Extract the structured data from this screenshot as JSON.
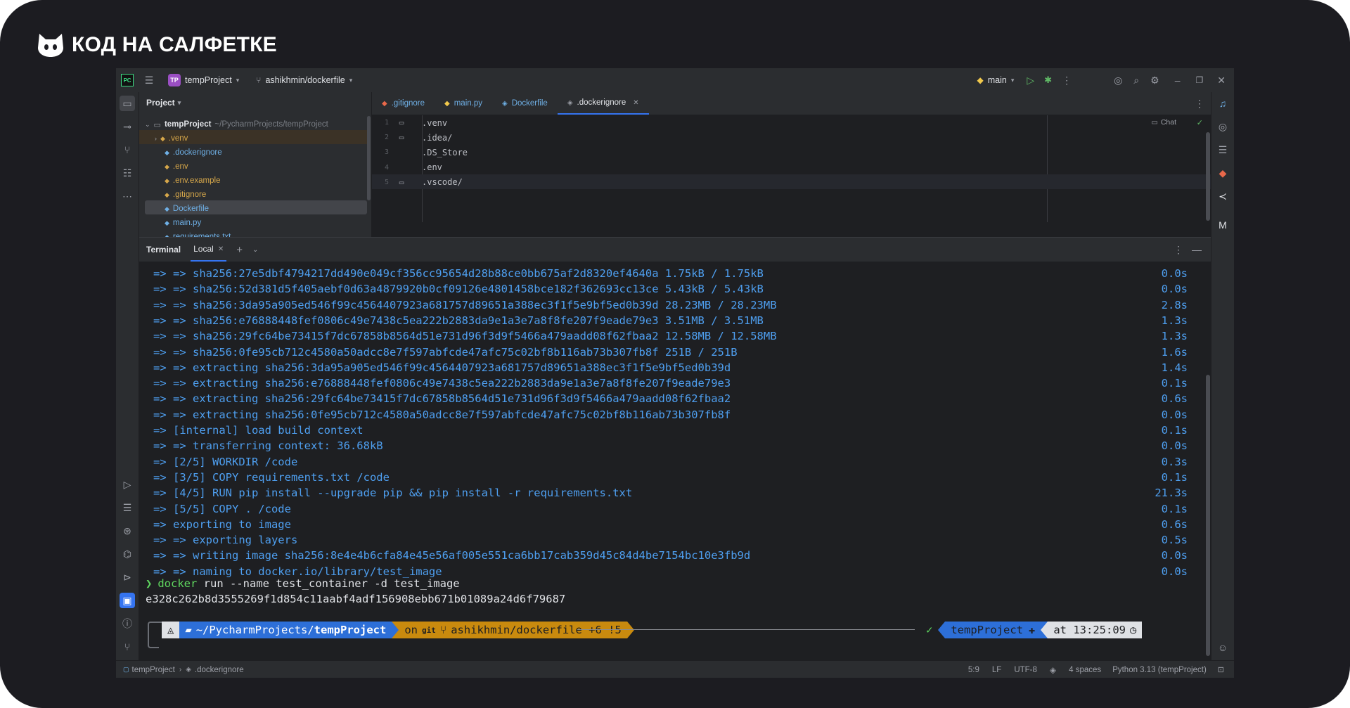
{
  "brand": {
    "name": "КОД НА САЛФЕТКЕ"
  },
  "topbar": {
    "project_badge": "TP",
    "project_name": "tempProject",
    "branch": "ashikhmin/dockerfile",
    "run_config": "main"
  },
  "project_panel": {
    "title": "Project",
    "root_name": "tempProject",
    "root_path": "~/PycharmProjects/tempProject",
    "items": [
      {
        "label": ".venv",
        "color": "#d6a74a"
      },
      {
        "label": ".dockerignore",
        "color": "#6fb0e6"
      },
      {
        "label": ".env",
        "color": "#d6a74a"
      },
      {
        "label": ".env.example",
        "color": "#d6a74a"
      },
      {
        "label": ".gitignore",
        "color": "#d6a74a"
      },
      {
        "label": "Dockerfile",
        "color": "#6fb0e6"
      },
      {
        "label": "main.py",
        "color": "#6fb0e6"
      },
      {
        "label": "requirements.txt",
        "color": "#6fb0e6"
      }
    ]
  },
  "editor": {
    "tabs": [
      ".gitignore",
      "main.py",
      "Dockerfile",
      ".dockerignore"
    ],
    "active_tab": ".dockerignore",
    "chat_label": "Chat",
    "lines": [
      ".venv",
      ".idea/",
      ".DS_Store",
      ".env",
      ".vscode/"
    ],
    "line_numbers": [
      "1",
      "2",
      "3",
      "4",
      "5"
    ]
  },
  "terminal": {
    "title": "Terminal",
    "tab": "Local",
    "lines": [
      {
        "text": "=> => sha256:27e5dbf4794217dd490e049cf356cc95654d28b88ce0bb675af2d8320ef4640a 1.75kB / 1.75kB",
        "time": "0.0s"
      },
      {
        "text": "=> => sha256:52d381d5f405aebf0d63a4879920b0cf09126e4801458bce182f362693cc13ce 5.43kB / 5.43kB",
        "time": "0.0s"
      },
      {
        "text": "=> => sha256:3da95a905ed546f99c4564407923a681757d89651a388ec3f1f5e9bf5ed0b39d 28.23MB / 28.23MB",
        "time": "2.8s"
      },
      {
        "text": "=> => sha256:e76888448fef0806c49e7438c5ea222b2883da9e1a3e7a8f8fe207f9eade79e3 3.51MB / 3.51MB",
        "time": "1.3s"
      },
      {
        "text": "=> => sha256:29fc64be73415f7dc67858b8564d51e731d96f3d9f5466a479aadd08f62fbaa2 12.58MB / 12.58MB",
        "time": "1.3s"
      },
      {
        "text": "=> => sha256:0fe95cb712c4580a50adcc8e7f597abfcde47afc75c02bf8b116ab73b307fb8f 251B / 251B",
        "time": "1.6s"
      },
      {
        "text": "=> => extracting sha256:3da95a905ed546f99c4564407923a681757d89651a388ec3f1f5e9bf5ed0b39d",
        "time": "1.4s"
      },
      {
        "text": "=> => extracting sha256:e76888448fef0806c49e7438c5ea222b2883da9e1a3e7a8f8fe207f9eade79e3",
        "time": "0.1s"
      },
      {
        "text": "=> => extracting sha256:29fc64be73415f7dc67858b8564d51e731d96f3d9f5466a479aadd08f62fbaa2",
        "time": "0.6s"
      },
      {
        "text": "=> => extracting sha256:0fe95cb712c4580a50adcc8e7f597abfcde47afc75c02bf8b116ab73b307fb8f",
        "time": "0.0s"
      },
      {
        "text": "=> [internal] load build context",
        "time": "0.1s"
      },
      {
        "text": "=> => transferring context: 36.68kB",
        "time": "0.0s"
      },
      {
        "text": "=> [2/5] WORKDIR /code",
        "time": "0.3s"
      },
      {
        "text": "=> [3/5] COPY requirements.txt /code",
        "time": "0.1s"
      },
      {
        "text": "=> [4/5] RUN pip install --upgrade pip && pip install -r requirements.txt",
        "time": "21.3s"
      },
      {
        "text": "=> [5/5] COPY . /code",
        "time": "0.1s"
      },
      {
        "text": "=> exporting to image",
        "time": "0.6s"
      },
      {
        "text": "=> => exporting layers",
        "time": "0.5s"
      },
      {
        "text": "=> => writing image sha256:8e4e4b6cfa84e45e56af005e551ca6bb17cab359d45c84d4be7154bc10e3fb9d",
        "time": "0.0s"
      },
      {
        "text": "=> => naming to docker.io/library/test_image",
        "time": "0.0s"
      }
    ],
    "prompt_char": "❯",
    "command_name": "docker",
    "command_args": " run --name test_container -d test_image",
    "output": "e328c262b8d3555269f1d854c11aabf4adf156908ebb671b01089a24d6f79687",
    "prompt": {
      "path_prefix": "~/PycharmProjects/",
      "path_dir": "tempProject",
      "git_on": "on",
      "git_label": "git",
      "git_branch": "ashikhmin/dockerfile +6 !5",
      "check": "✓",
      "venv": "tempProject",
      "time": "at 13:25:09"
    }
  },
  "statusbar": {
    "crumb_root": "tempProject",
    "crumb_file": ".dockerignore",
    "position": "5:9",
    "line_sep": "LF",
    "encoding": "UTF-8",
    "indent": "4 spaces",
    "interpreter": "Python 3.13 (tempProject)"
  },
  "colors": {
    "frame": "#1c1c21",
    "ide_bg": "#1e1f22",
    "panel_bg": "#2b2d30",
    "term_text": "#4e9ff0",
    "accent": "#3574f0",
    "prompt_orange": "#c98a0e"
  }
}
